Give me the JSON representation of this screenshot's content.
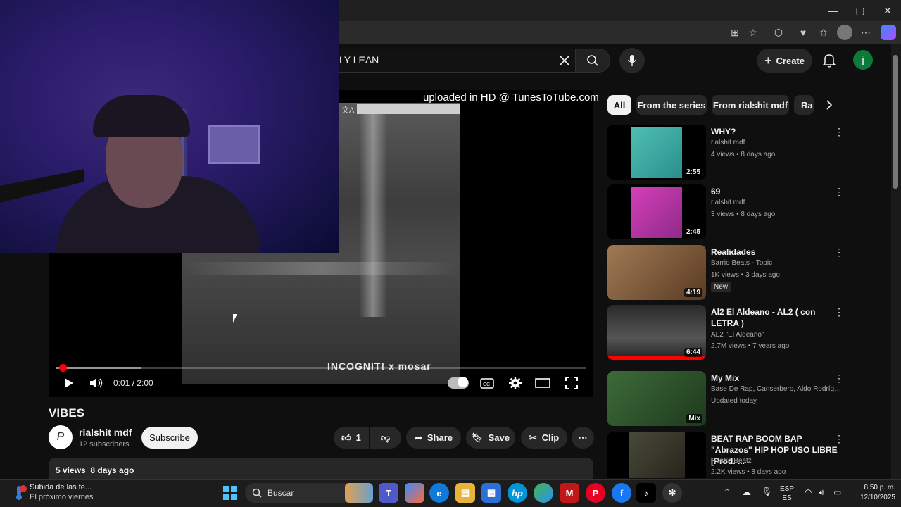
{
  "browser": {
    "min": "—",
    "max": "▢",
    "close": "✕"
  },
  "header": {
    "search_value": "LY LEAN",
    "create_label": "Create",
    "avatar_letter": "j"
  },
  "player": {
    "overlay_text": "uploaded in HD @ TunesToTube.com",
    "cover_caption": "INCOGNIT! x mosar",
    "time": "0:01 / 2:00",
    "progress_fraction": 0.005,
    "buffered_fraction": 0.16
  },
  "video": {
    "title": "VIBES",
    "channel_name": "rialshit mdf",
    "subscribers": "12 subscribers",
    "subscribe_label": "Subscribe",
    "likes": "1",
    "share_label": "Share",
    "save_label": "Save",
    "clip_label": "Clip",
    "description_meta": "5 views  8 days ago"
  },
  "chips": [
    "All",
    "From the series",
    "From rialshit mdf",
    "Ra"
  ],
  "recommendations": [
    {
      "title": "WHY?",
      "channel": "rialshit mdf",
      "meta": "4 views • 8 days ago",
      "duration": "2:55"
    },
    {
      "title": "69",
      "channel": "rialshit mdf",
      "meta": "3 views • 8 days ago",
      "duration": "2:45"
    },
    {
      "title": "Realidades",
      "channel": "Barrio Beats - Topic",
      "meta": "1K views • 3 days ago",
      "duration": "4:19",
      "badge": "New"
    },
    {
      "title": "Al2 El Aldeano - AL2 ( con LETRA )",
      "channel": "AL2 \"El Aldeano\"",
      "meta": "2.7M views • 7 years ago",
      "duration": "6:44"
    },
    {
      "title": "My Mix",
      "channel": "Base De Rap, Canserbero, Aldo Rodrígue...",
      "meta": "Updated today",
      "duration": "Mix"
    },
    {
      "title": "BEAT RAP BOOM BAP \"Abrazos\" HIP HOP USO LIBRE - [Prod. ...",
      "channel": "Rostro Beatz",
      "meta": "2.2K views • 8 days ago",
      "duration": ""
    }
  ],
  "taskbar": {
    "weather_title": "Subida de las te...",
    "weather_sub": "El próximo viernes",
    "search_placeholder": "Buscar",
    "lang_top": "ESP",
    "lang_bottom": "ES",
    "time": "8:50 p. m.",
    "date": "12/10/2025"
  },
  "colors": {
    "accent_red": "#ff0000",
    "avatar_green": "#0b7a3b",
    "background": "#0f0f0f"
  }
}
